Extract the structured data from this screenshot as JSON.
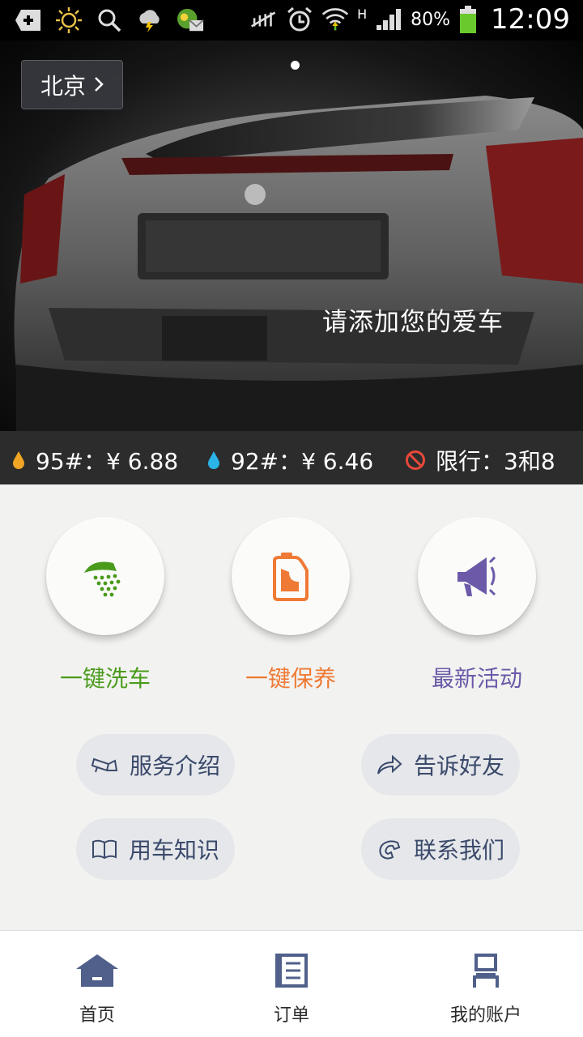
{
  "status_bar": {
    "battery_pct": "80%",
    "time": "12:09",
    "network": "H"
  },
  "hero": {
    "city_label": "北京",
    "message": "请添加您的爱车"
  },
  "info_bar": {
    "fuel95": "95#：¥ 6.88",
    "fuel92": "92#：¥ 6.46",
    "restriction": "限行：3和8"
  },
  "actions": [
    {
      "label": "一键洗车",
      "color": "#4a9b1c"
    },
    {
      "label": "一键保养",
      "color": "#ef7a35"
    },
    {
      "label": "最新活动",
      "color": "#6c5aa8"
    }
  ],
  "pills": {
    "service_intro": "服务介绍",
    "tell_friends": "告诉好友",
    "car_knowledge": "用车知识",
    "contact_us": "联系我们"
  },
  "bottom_nav": {
    "home": "首页",
    "orders": "订单",
    "account": "我的账户"
  }
}
